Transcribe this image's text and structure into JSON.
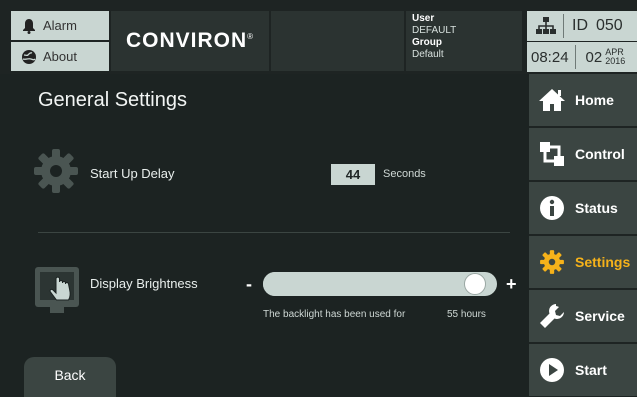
{
  "header": {
    "alarm_label": "Alarm",
    "about_label": "About",
    "logo": "CONVIRON",
    "logo_mark": "®",
    "user_key": "User",
    "user_value": "DEFAULT",
    "group_key": "Group",
    "group_value": "Default",
    "id_label": "ID",
    "id_value": "050",
    "time": "08:24",
    "day": "02",
    "month": "APR",
    "year": "2016"
  },
  "nav": {
    "items": [
      {
        "label": "Home",
        "icon": "home-icon"
      },
      {
        "label": "Control",
        "icon": "control-icon"
      },
      {
        "label": "Status",
        "icon": "info-icon"
      },
      {
        "label": "Settings",
        "icon": "gear-icon",
        "active": true
      },
      {
        "label": "Service",
        "icon": "wrench-icon"
      },
      {
        "label": "Start",
        "icon": "play-icon"
      }
    ]
  },
  "main": {
    "title": "General Settings",
    "startup": {
      "label": "Start Up Delay",
      "value": "44",
      "unit": "Seconds"
    },
    "brightness": {
      "label": "Display Brightness",
      "minus": "-",
      "plus": "+",
      "level": 0.95
    },
    "backlight": {
      "text": "The backlight has been used for",
      "value": "55 hours"
    },
    "back_label": "Back"
  },
  "colors": {
    "background": "#1c2322",
    "panel": "#3b4542",
    "light": "#c9d6d2",
    "accent": "#f6b21a"
  }
}
